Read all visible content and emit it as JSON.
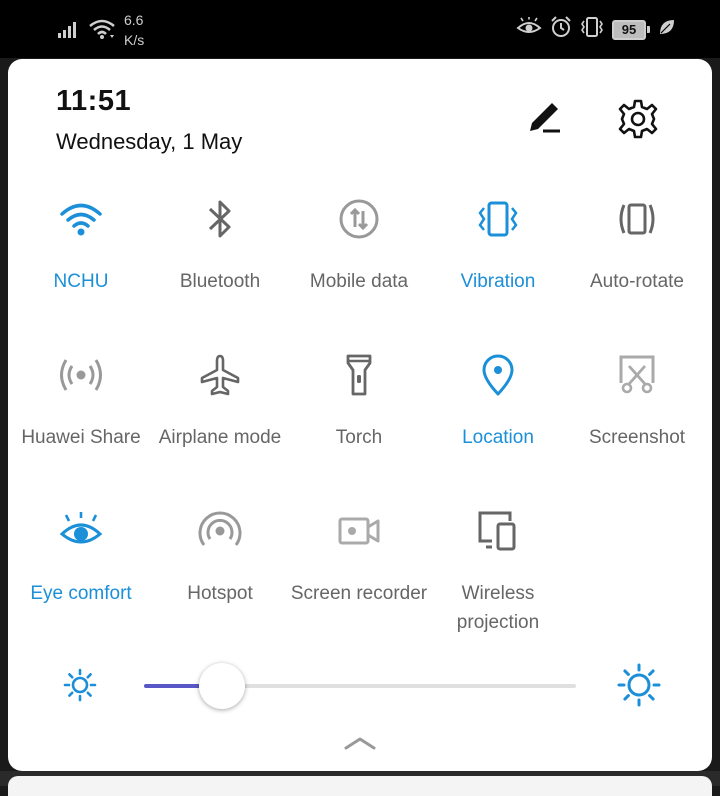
{
  "status_bar": {
    "net_speed_value": "6.6",
    "net_speed_unit": "K/s",
    "battery_level": "95",
    "icons": [
      "signal-icon",
      "wifi-icon",
      "eye-comfort-icon",
      "alarm-icon",
      "vibrate-icon",
      "battery-icon",
      "leaf-icon"
    ]
  },
  "header": {
    "time": "11:51",
    "date": "Wednesday, 1 May",
    "edit_icon": "pencil-icon",
    "settings_icon": "gear-icon"
  },
  "tiles": [
    {
      "label": "NCHU",
      "icon": "wifi-icon",
      "active": true
    },
    {
      "label": "Bluetooth",
      "icon": "bluetooth-icon",
      "active": false
    },
    {
      "label": "Mobile data",
      "icon": "mobile-data-icon",
      "active": false
    },
    {
      "label": "Vibration",
      "icon": "vibration-icon",
      "active": true
    },
    {
      "label": "Auto-rotate",
      "icon": "auto-rotate-icon",
      "active": false
    },
    {
      "label": "Huawei Share",
      "icon": "huawei-share-icon",
      "active": false
    },
    {
      "label": "Airplane mode",
      "icon": "airplane-icon",
      "active": false
    },
    {
      "label": "Torch",
      "icon": "torch-icon",
      "active": false
    },
    {
      "label": "Location",
      "icon": "location-pin-icon",
      "active": true
    },
    {
      "label": "Screenshot",
      "icon": "screenshot-icon",
      "active": false
    },
    {
      "label": "Eye comfort",
      "icon": "eye-icon",
      "active": true
    },
    {
      "label": "Hotspot",
      "icon": "hotspot-icon",
      "active": false
    },
    {
      "label": "Screen recorder",
      "icon": "screen-recorder-icon",
      "active": false
    },
    {
      "label": "Wireless projection",
      "icon": "wireless-projection-icon",
      "active": false
    }
  ],
  "brightness": {
    "level": 0.18,
    "low_icon": "sun-small-icon",
    "high_icon": "sun-large-icon"
  },
  "colors": {
    "accent": "#1b8fd8",
    "inactive": "#666666",
    "slider_fill": "#5858c8"
  }
}
